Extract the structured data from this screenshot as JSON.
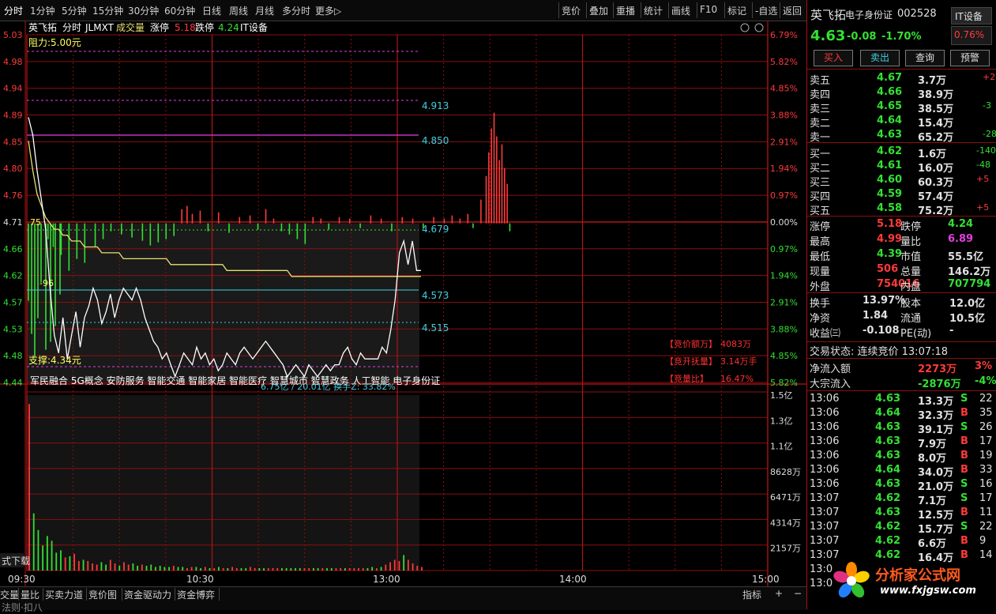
{
  "topbar": {
    "left_tabs": [
      "分时",
      "1分钟",
      "5分钟",
      "15分钟",
      "30分钟",
      "60分钟",
      "日线",
      "周线",
      "月线",
      "多分时",
      "更多▷"
    ],
    "right_tabs": [
      "竞价",
      "叠加",
      "重播",
      "统计",
      "画线",
      "F10",
      "标记",
      "-自选",
      "返回"
    ]
  },
  "chart_header": {
    "name": "英飞拓",
    "period": "分时",
    "indicator": "JLMXT",
    "vol_label": "成交量",
    "limit_up_label": "涨停",
    "limit_up": "5.18",
    "limit_down_label": "跌停",
    "limit_down": "4.24",
    "sector": "IT设备"
  },
  "price_axis_left": [
    "5.03",
    "4.98",
    "4.94",
    "4.89",
    "4.85",
    "4.80",
    "4.76",
    "4.71",
    "4.66",
    "4.62",
    "4.57",
    "4.53",
    "4.48",
    "4.44"
  ],
  "pct_axis_right": [
    "6.79%",
    "5.82%",
    "4.85%",
    "3.88%",
    "2.91%",
    "1.94%",
    "0.97%",
    "0.00%",
    "0.97%",
    "1.94%",
    "2.91%",
    "3.88%",
    "4.85%",
    "5.82%"
  ],
  "vol_axis": [
    "1.5亿",
    "1.3亿",
    "1.1亿",
    "8628万",
    "6471万",
    "4314万",
    "2157万"
  ],
  "time_axis": [
    "09:30",
    "10:30",
    "13:00",
    "14:00",
    "15:00"
  ],
  "levels": {
    "resistance": "阻力:5.00元",
    "l1": "4.913",
    "l2": "4.850",
    "l3": "4.679",
    "l4": "4.573",
    "l5": "4.515",
    "support": "支撑:4.34元",
    "left_a": "75",
    "left_b": "-96"
  },
  "tags": "军民融合 5G概念 安防服务 智能交通 智能家居 智能医疗 智慧城市 智慧政务 人工智能 电子身份证",
  "amount_overlay": "6.75亿 / 20.01亿  换手Z: 33.82%",
  "auction": [
    {
      "label": "【竞价额万】",
      "value": "4083万"
    },
    {
      "label": "【竞开抚量】",
      "value": "3.14万手"
    },
    {
      "label": "【竞量比】",
      "value": "16.47%"
    }
  ],
  "left_edge_text": "式下载",
  "bottom_tabs": [
    "交量",
    "量比",
    "买卖力道",
    "竞价图",
    "资金驱动力",
    "资金博弈"
  ],
  "bottom_right": [
    "指标",
    "+",
    "−"
  ],
  "bottom_cut": "法则·扣八",
  "right_panel": {
    "title": "英飞拓",
    "concept": "电子身份证",
    "code": "002528",
    "sector": "IT设备",
    "price": "4.63",
    "change": "-0.08",
    "change_pct": "-1.70%",
    "sector_pct": "0.76%",
    "buttons": [
      "买入",
      "卖出",
      "查询",
      "预警"
    ],
    "asks": [
      {
        "label": "卖五",
        "price": "4.67",
        "vol": "3.7万",
        "chg": "+2"
      },
      {
        "label": "卖四",
        "price": "4.66",
        "vol": "38.9万",
        "chg": ""
      },
      {
        "label": "卖三",
        "price": "4.65",
        "vol": "38.5万",
        "chg": "-3"
      },
      {
        "label": "卖二",
        "price": "4.64",
        "vol": "15.4万",
        "chg": ""
      },
      {
        "label": "卖一",
        "price": "4.63",
        "vol": "65.2万",
        "chg": "-28"
      }
    ],
    "bids": [
      {
        "label": "买一",
        "price": "4.62",
        "vol": "1.6万",
        "chg": "-140"
      },
      {
        "label": "买二",
        "price": "4.61",
        "vol": "16.0万",
        "chg": "-48"
      },
      {
        "label": "买三",
        "price": "4.60",
        "vol": "60.3万",
        "chg": "+5"
      },
      {
        "label": "买四",
        "price": "4.59",
        "vol": "57.4万",
        "chg": ""
      },
      {
        "label": "买五",
        "price": "4.58",
        "vol": "75.2万",
        "chg": "+5"
      }
    ],
    "stats": [
      {
        "l1": "涨停",
        "v1": "5.18",
        "c1": "r",
        "l2": "跌停",
        "v2": "4.24",
        "c2": "g"
      },
      {
        "l1": "最高",
        "v1": "4.99",
        "c1": "r",
        "l2": "量比",
        "v2": "6.89",
        "c2": "m"
      },
      {
        "l1": "最低",
        "v1": "4.39",
        "c1": "g",
        "l2": "市值",
        "v2": "55.5亿",
        "c2": "w"
      },
      {
        "l1": "现量",
        "v1": "506",
        "c1": "r",
        "l2": "总量",
        "v2": "146.2万",
        "c2": "w"
      },
      {
        "l1": "外盘",
        "v1": "754016",
        "c1": "r",
        "l2": "内盘",
        "v2": "707794",
        "c2": "g"
      }
    ],
    "stats2": [
      {
        "l1": "换手",
        "v1": "13.97%",
        "l2": "股本",
        "v2": "12.0亿"
      },
      {
        "l1": "净资",
        "v1": "1.84",
        "l2": "流通",
        "v2": "10.5亿"
      },
      {
        "l1": "收益㈢",
        "v1": "-0.108",
        "l2": "PE(动)",
        "v2": "-"
      }
    ],
    "status": "交易状态: 连续竞价 13:07:18",
    "flows": [
      {
        "label": "净流入额",
        "value": "2273万",
        "pct": "3%",
        "color": "r"
      },
      {
        "label": "大宗流入",
        "value": "-2876万",
        "pct": "-4%",
        "color": "g"
      }
    ],
    "ticks": [
      {
        "t": "13:06",
        "p": "4.63",
        "v": "13.3万",
        "d": "S",
        "n": "22"
      },
      {
        "t": "13:06",
        "p": "4.64",
        "v": "32.3万",
        "d": "B",
        "n": "35"
      },
      {
        "t": "13:06",
        "p": "4.63",
        "v": "39.1万",
        "d": "S",
        "n": "26"
      },
      {
        "t": "13:06",
        "p": "4.63",
        "v": "7.9万",
        "d": "B",
        "n": "17"
      },
      {
        "t": "13:06",
        "p": "4.63",
        "v": "8.0万",
        "d": "B",
        "n": "19"
      },
      {
        "t": "13:06",
        "p": "4.64",
        "v": "34.0万",
        "d": "B",
        "n": "33"
      },
      {
        "t": "13:06",
        "p": "4.63",
        "v": "21.0万",
        "d": "S",
        "n": "16"
      },
      {
        "t": "13:07",
        "p": "4.62",
        "v": "7.1万",
        "d": "S",
        "n": "17"
      },
      {
        "t": "13:07",
        "p": "4.63",
        "v": "12.5万",
        "d": "B",
        "n": "11"
      },
      {
        "t": "13:07",
        "p": "4.62",
        "v": "15.7万",
        "d": "S",
        "n": "22"
      },
      {
        "t": "13:07",
        "p": "4.62",
        "v": "6.6万",
        "d": "B",
        "n": "9"
      },
      {
        "t": "13:07",
        "p": "4.62",
        "v": "16.4万",
        "d": "B",
        "n": "14"
      },
      {
        "t": "13:0",
        "p": "",
        "v": "",
        "d": "",
        "n": ""
      },
      {
        "t": "13:0",
        "p": "",
        "v": "",
        "d": "",
        "n": ""
      }
    ],
    "logo": {
      "name": "分析家公式网",
      "url": "www.fxjgsw.com"
    }
  },
  "colors": {
    "grid": "#8a1010",
    "up": "#ff3a3a",
    "down": "#33e033",
    "avg": "#e8e070",
    "price": "#ffffff",
    "level": "#40d0e0",
    "resist": "#e040e0"
  },
  "chart_data": {
    "type": "line",
    "x_range": [
      "09:30",
      "15:00"
    ],
    "y_range": [
      4.44,
      5.03
    ],
    "prev_close": 4.71,
    "price_series": [
      4.89,
      4.86,
      4.8,
      4.75,
      4.7,
      4.6,
      4.52,
      4.49,
      4.55,
      4.48,
      4.52,
      4.56,
      4.5,
      4.55,
      4.57,
      4.6,
      4.58,
      4.54,
      4.56,
      4.59,
      4.55,
      4.58,
      4.6,
      4.59,
      4.58,
      4.6,
      4.58,
      4.55,
      4.53,
      4.51,
      4.5,
      4.48,
      4.49,
      4.47,
      4.45,
      4.47,
      4.49,
      4.48,
      4.47,
      4.5,
      4.48,
      4.49,
      4.47,
      4.48,
      4.46,
      4.47,
      4.49,
      4.48,
      4.47,
      4.49,
      4.5,
      4.49,
      4.48,
      4.49,
      4.5,
      4.51,
      4.5,
      4.49,
      4.48,
      4.47,
      4.45,
      4.46,
      4.47,
      4.46,
      4.45,
      4.47,
      4.46,
      4.45,
      4.46,
      4.47,
      4.46,
      4.47,
      4.47,
      4.49,
      4.5,
      4.48,
      4.47,
      4.49,
      4.48,
      4.48,
      4.48,
      4.48,
      4.5,
      4.49,
      4.53,
      4.58,
      4.66,
      4.68,
      4.64,
      4.68,
      4.63,
      4.63
    ],
    "avg_series": [
      4.85,
      4.8,
      4.76,
      4.74,
      4.72,
      4.71,
      4.7,
      4.7,
      4.69,
      4.69,
      4.68,
      4.68,
      4.68,
      4.67,
      4.67,
      4.67,
      4.67,
      4.66,
      4.66,
      4.66,
      4.66,
      4.66,
      4.65,
      4.65,
      4.65,
      4.65,
      4.65,
      4.65,
      4.65,
      4.65,
      4.65,
      4.65,
      4.65,
      4.64,
      4.64,
      4.64,
      4.64,
      4.64,
      4.64,
      4.64,
      4.64,
      4.64,
      4.64,
      4.64,
      4.64,
      4.64,
      4.63,
      4.63,
      4.63,
      4.63,
      4.63,
      4.63,
      4.63,
      4.63,
      4.63,
      4.63,
      4.63,
      4.63,
      4.63,
      4.63,
      4.63,
      4.62,
      4.62,
      4.62,
      4.62,
      4.62,
      4.62,
      4.62,
      4.62,
      4.62,
      4.62,
      4.62,
      4.62,
      4.62,
      4.62,
      4.62,
      4.62,
      4.62,
      4.62,
      4.62,
      4.62,
      4.62,
      4.62,
      4.62,
      4.62,
      4.62,
      4.62,
      4.62,
      4.62,
      4.62,
      4.62,
      4.62
    ],
    "volume_wan": [
      14000,
      4800,
      3400,
      2100,
      2900,
      2500,
      1500,
      1700,
      1100,
      1200,
      1400,
      800,
      900,
      800,
      600,
      500,
      700,
      500,
      900,
      600,
      400,
      700,
      500,
      600,
      400,
      500,
      400,
      500,
      300,
      400,
      300,
      300,
      400,
      300,
      300,
      200,
      300,
      300,
      200,
      300,
      200,
      200,
      300,
      200,
      200,
      300,
      200,
      200,
      200,
      300,
      200,
      200,
      200,
      200,
      200,
      200,
      200,
      200,
      200,
      200,
      200,
      200,
      200,
      200,
      200,
      200,
      200,
      200,
      200,
      200,
      200,
      200,
      200,
      200,
      200,
      200,
      300,
      200,
      300,
      500,
      700,
      900,
      800,
      1300,
      900,
      600,
      400,
      300
    ]
  }
}
